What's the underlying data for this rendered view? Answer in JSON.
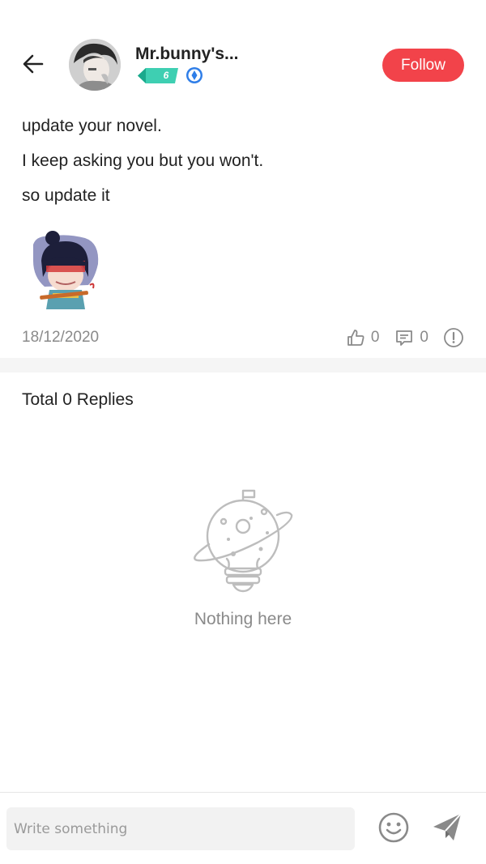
{
  "header": {
    "username": "Mr.bunny's...",
    "level": "6",
    "follow_label": "Follow"
  },
  "post": {
    "lines": [
      "update your novel.",
      "I keep asking you but you won't.",
      "so update it"
    ],
    "date": "18/12/2020",
    "likes": "0",
    "comments": "0"
  },
  "replies": {
    "title": "Total 0 Replies",
    "empty_text": "Nothing here"
  },
  "composer": {
    "placeholder": "Write something"
  },
  "colors": {
    "accent": "#f2434a",
    "badge": "#3ecfb2",
    "verified": "#2f7ee8",
    "muted": "#8a8a8a"
  },
  "icons": [
    "back-arrow-icon",
    "verified-icon",
    "thumbs-up-icon",
    "comment-icon",
    "report-icon",
    "planet-bulb-icon",
    "emoji-icon",
    "send-icon"
  ]
}
